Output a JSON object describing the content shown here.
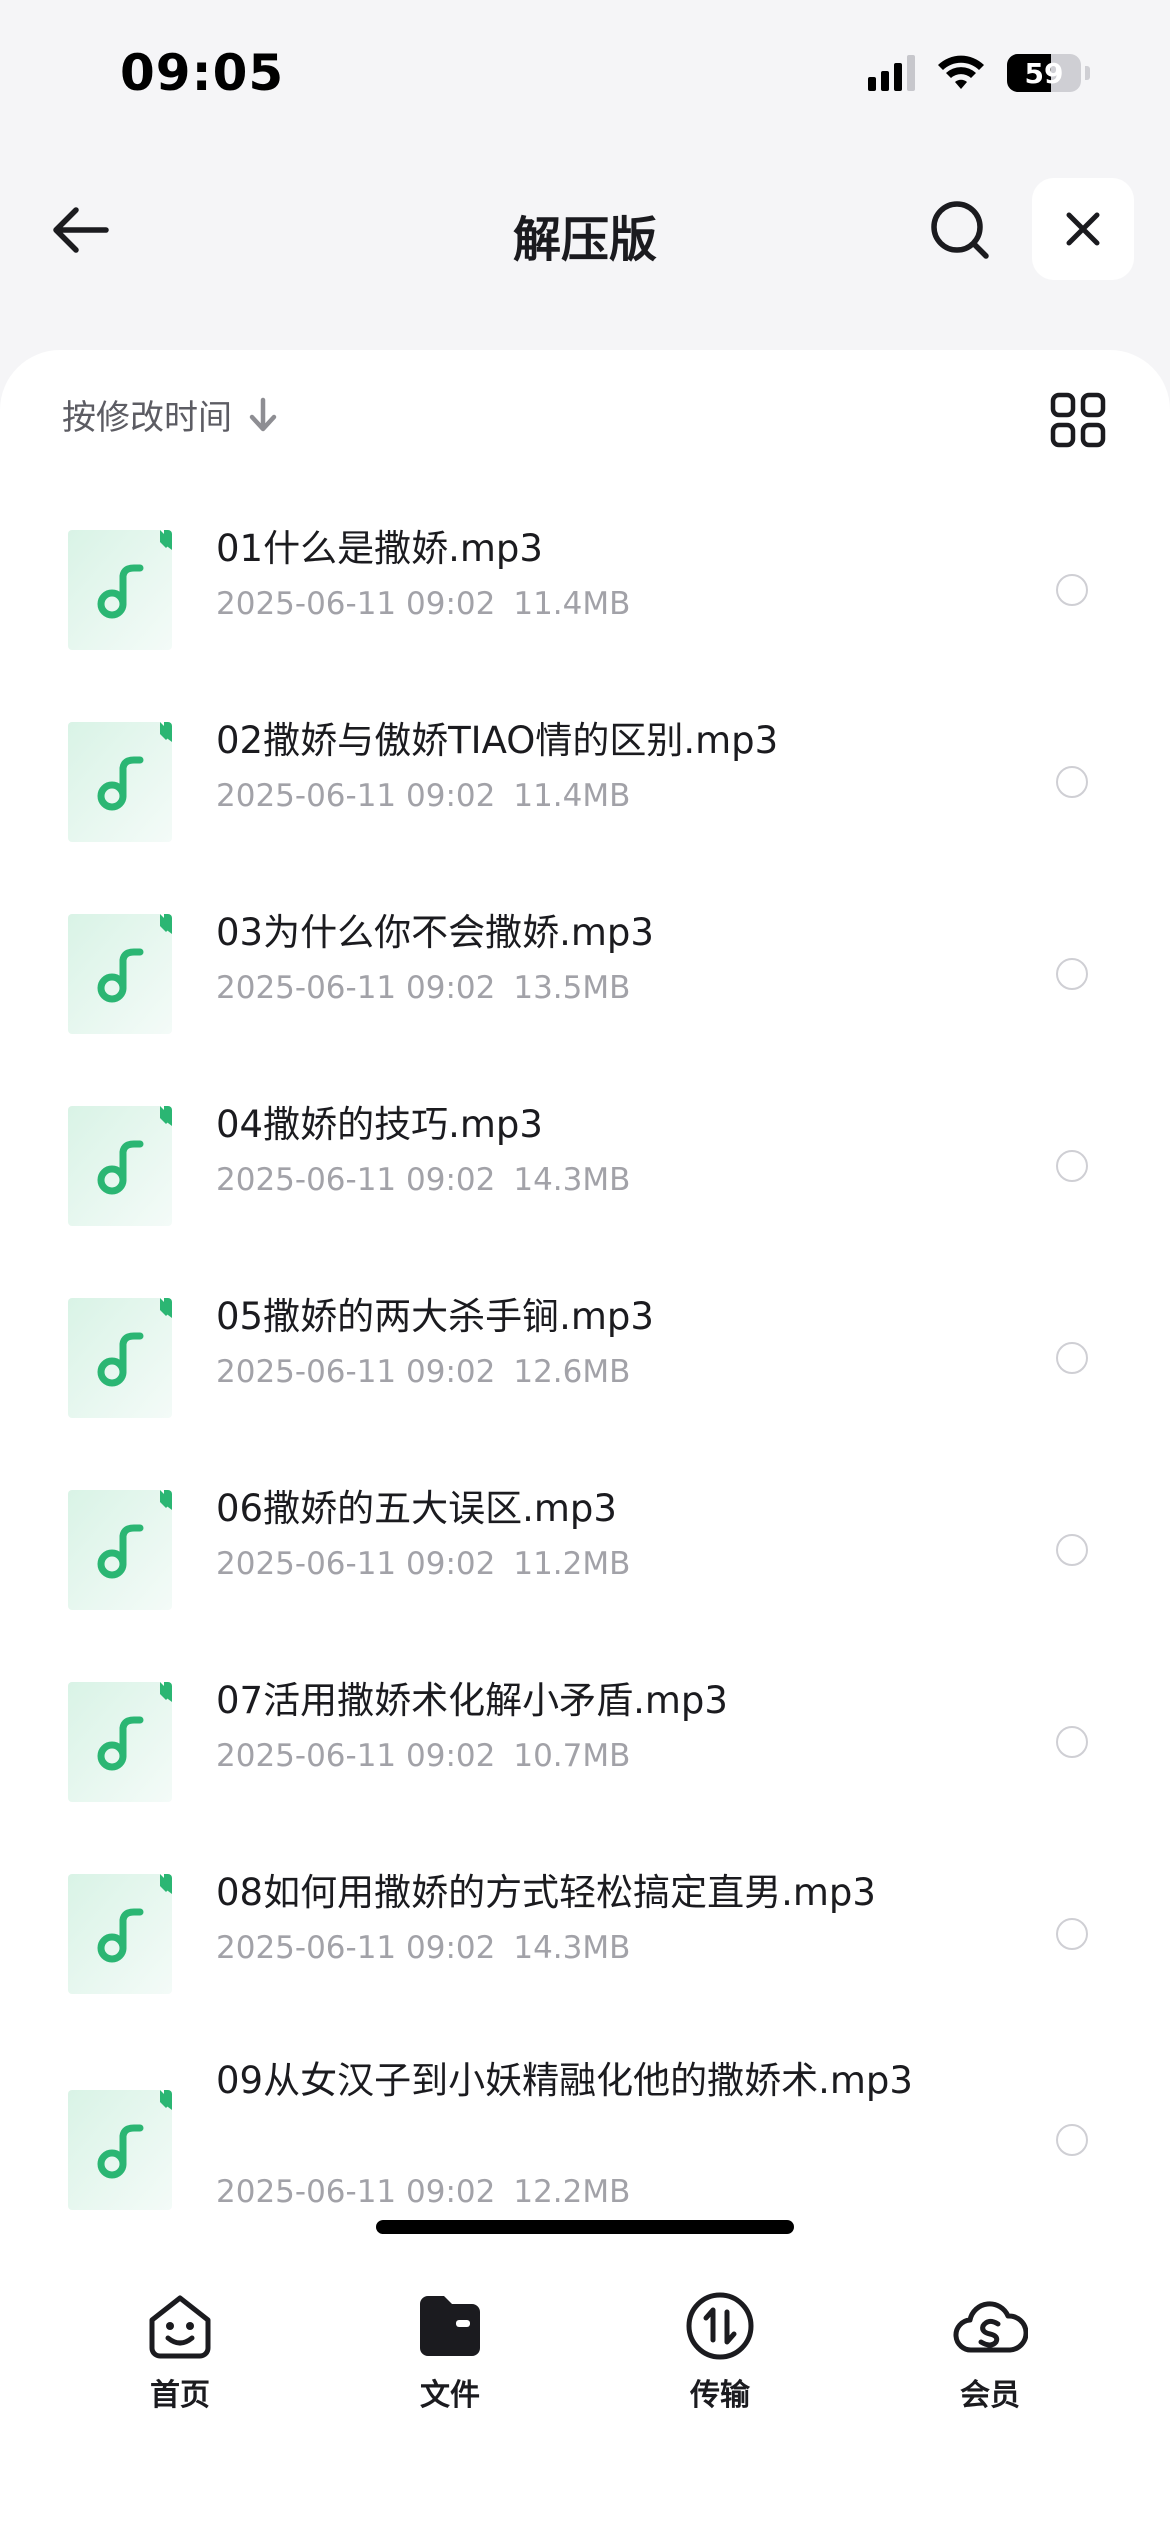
{
  "status_bar": {
    "time": "09:05",
    "battery": "59",
    "battery_level": 0.59
  },
  "header": {
    "title": "解压版",
    "back_icon": "arrow-left-icon",
    "search_icon": "search-icon",
    "close_icon": "close-icon"
  },
  "toolbar": {
    "sort_label": "按修改时间",
    "sort_icon": "arrow-down-icon",
    "view_icon": "grid-view-icon"
  },
  "files": [
    {
      "name": "01什么是撒娇.mp3",
      "date": "2025-06-11 09:02",
      "size": "11.4MB"
    },
    {
      "name": "02撒娇与傲娇TIAO情的区别.mp3",
      "date": "2025-06-11 09:02",
      "size": "11.4MB"
    },
    {
      "name": "03为什么你不会撒娇.mp3",
      "date": "2025-06-11 09:02",
      "size": "13.5MB"
    },
    {
      "name": "04撒娇的技巧.mp3",
      "date": "2025-06-11 09:02",
      "size": "14.3MB"
    },
    {
      "name": "05撒娇的两大杀手锏.mp3",
      "date": "2025-06-11 09:02",
      "size": "12.6MB"
    },
    {
      "name": "06撒娇的五大误区.mp3",
      "date": "2025-06-11 09:02",
      "size": "11.2MB"
    },
    {
      "name": "07活用撒娇术化解小矛盾.mp3",
      "date": "2025-06-11 09:02",
      "size": "10.7MB"
    },
    {
      "name": "08如何用撒娇的方式轻松搞定直男.mp3",
      "date": "2025-06-11 09:02",
      "size": "14.3MB"
    },
    {
      "name": "09从女汉子到小妖精融化他的撒娇术.mp3",
      "date": "2025-06-11 09:02",
      "size": "12.2MB"
    }
  ],
  "nav": {
    "home": "首页",
    "files": "文件",
    "transfer": "传输",
    "vip": "会员"
  },
  "colors": {
    "accent_green": "#2bb673",
    "icon_bg": "#e6f6ee"
  }
}
